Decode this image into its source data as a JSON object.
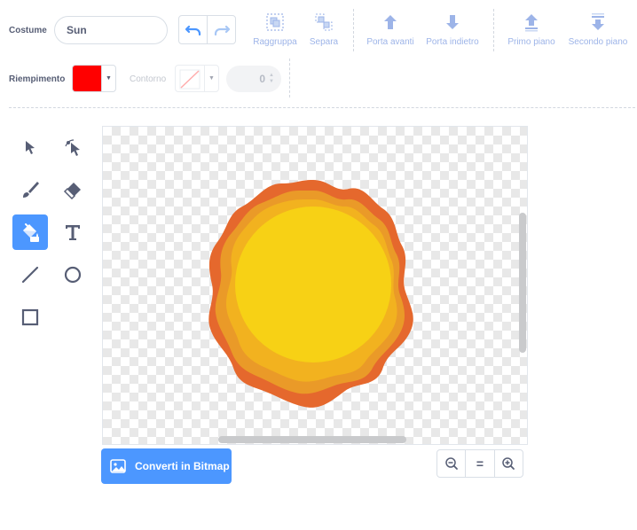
{
  "toolbar": {
    "costume_label": "Costume",
    "costume_name": "Sun",
    "undo": "undo",
    "redo": "redo",
    "buttons": [
      {
        "label": "Raggruppa",
        "icon": "group-icon"
      },
      {
        "label": "Separa",
        "icon": "ungroup-icon"
      },
      {
        "label": "Porta avanti",
        "icon": "forward-icon"
      },
      {
        "label": "Porta indietro",
        "icon": "backward-icon"
      },
      {
        "label": "Primo piano",
        "icon": "front-icon"
      },
      {
        "label": "Secondo piano",
        "icon": "back-icon"
      }
    ]
  },
  "fill": {
    "label": "Riempimento",
    "color": "#ff0000"
  },
  "outline": {
    "label": "Contorno",
    "width": "0"
  },
  "tools": [
    {
      "name": "select-tool",
      "icon": "arrow-icon"
    },
    {
      "name": "reshape-tool",
      "icon": "reshape-icon"
    },
    {
      "name": "brush-tool",
      "icon": "brush-icon"
    },
    {
      "name": "eraser-tool",
      "icon": "eraser-icon"
    },
    {
      "name": "fill-tool",
      "icon": "fill-bucket-icon",
      "active": true
    },
    {
      "name": "text-tool",
      "icon": "text-icon"
    },
    {
      "name": "line-tool",
      "icon": "line-icon"
    },
    {
      "name": "circle-tool",
      "icon": "circle-icon"
    },
    {
      "name": "rectangle-tool",
      "icon": "rectangle-icon"
    }
  ],
  "canvas": {
    "sprite": "sun",
    "colors": {
      "outer": "#e5682d",
      "middle": "#ea9a28",
      "inner": "#f2b21f",
      "core": "#f7d115"
    }
  },
  "footer": {
    "bitmap_label": "Converti in Bitmap",
    "zoom_reset": "="
  },
  "colors": {
    "accent": "#4c97ff",
    "text": "#575e75",
    "disabled": "#9db4e8"
  }
}
